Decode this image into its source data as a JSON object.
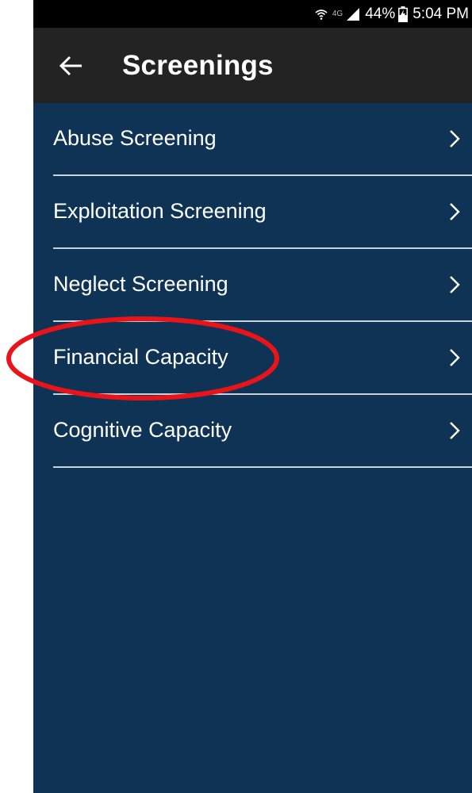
{
  "status_bar": {
    "network": "4G",
    "battery": "44%",
    "time": "5:04 PM"
  },
  "header": {
    "title": "Screenings",
    "back_icon": "arrow-left-icon"
  },
  "menu": {
    "items": [
      {
        "label": "Abuse Screening"
      },
      {
        "label": "Exploitation Screening"
      },
      {
        "label": "Neglect Screening"
      },
      {
        "label": "Financial Capacity"
      },
      {
        "label": "Cognitive Capacity"
      }
    ]
  },
  "colors": {
    "background": "#0f3354",
    "app_bar": "#232323",
    "status_bar": "#000000",
    "divider": "#c8d0d8",
    "highlight": "#e8141a"
  },
  "annotation": {
    "highlighted_item": "Financial Capacity"
  }
}
